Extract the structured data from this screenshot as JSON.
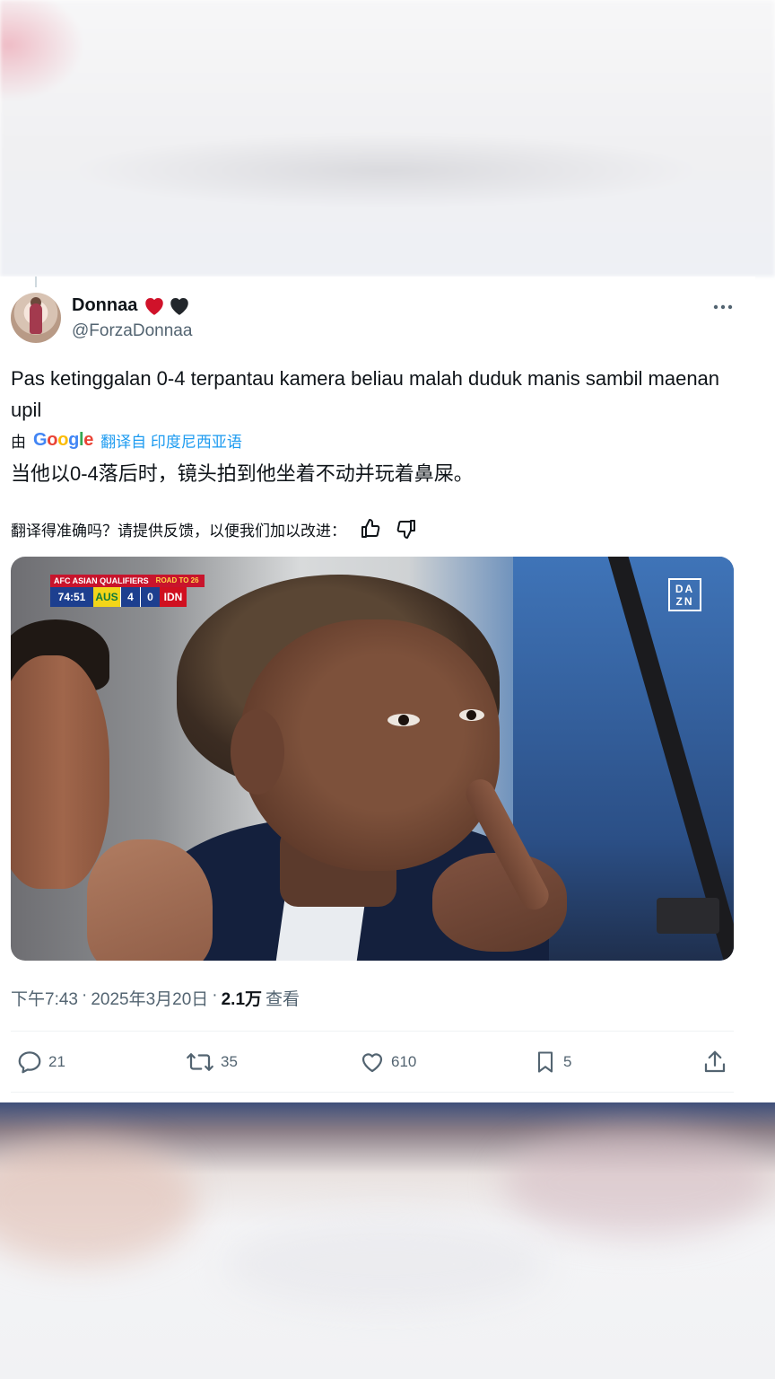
{
  "user": {
    "name": "Donnaa",
    "handle": "@ForzaDonnaa"
  },
  "tweet": {
    "text": "Pas ketinggalan 0-4 terpantau kamera beliau malah duduk manis sambil maenan upil",
    "translated_prefix": "由",
    "translated_by": "Google",
    "translated_from": "翻译自 印度尼西亚语",
    "translation": "当他以0-4落后时，镜头拍到他坐着不动并玩着鼻屎。",
    "feedback_prompt": "翻译得准确吗？请提供反馈，以便我们加以改进："
  },
  "media": {
    "scoreboard": {
      "competition": "AFC ASIAN QUALIFIERS",
      "tag": "ROAD TO 26",
      "time": "74:51",
      "home": "AUS",
      "home_score": "4",
      "away_score": "0",
      "away": "IDN"
    },
    "broadcaster": "DA ZN"
  },
  "meta": {
    "time": "下午7:43",
    "date": "2025年3月20日",
    "views_count": "2.1万",
    "views_label": "查看",
    "sep": "·"
  },
  "actions": {
    "replies": "21",
    "retweets": "35",
    "likes": "610",
    "bookmarks": "5"
  },
  "icons": [
    "heart-red-icon",
    "heart-black-icon",
    "more-icon",
    "thumbs-up-icon",
    "thumbs-down-icon",
    "reply-icon",
    "retweet-icon",
    "like-icon",
    "bookmark-icon",
    "share-icon"
  ],
  "colors": {
    "link": "#1d9bf0",
    "secondary": "#536471",
    "primary_text": "#0f1419"
  }
}
